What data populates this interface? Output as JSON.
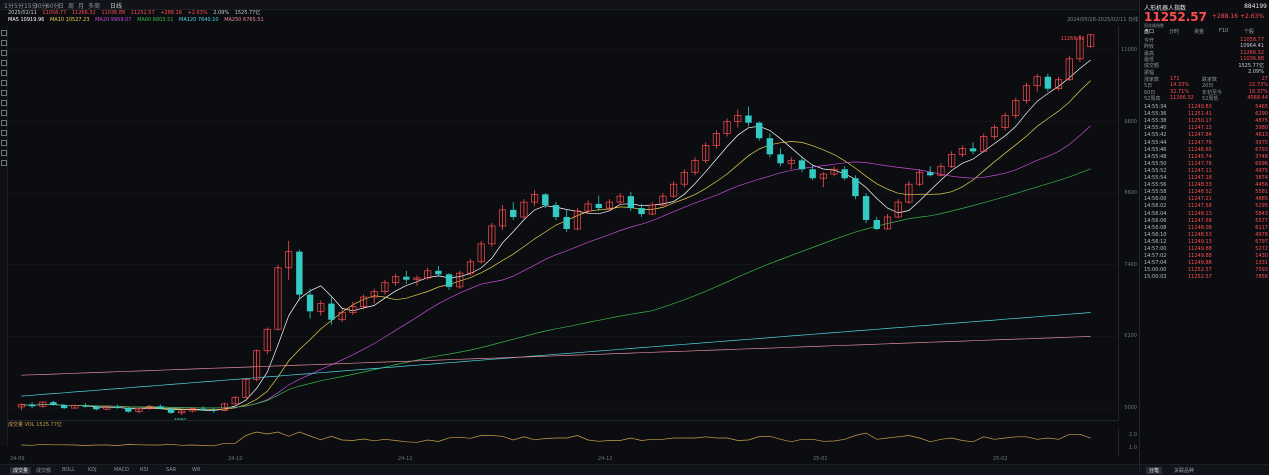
{
  "toolbar": {
    "items": [
      "1分",
      "5分",
      "15分",
      "30分",
      "60分",
      "日",
      "周",
      "月",
      "多周"
    ],
    "chart_mode": "日线"
  },
  "infobar": {
    "date": "2025/02/11",
    "open": "11058.77",
    "high": "11266.32",
    "low": "11036.88",
    "close": "11252.57",
    "change": "+288.16",
    "pct": "+2.63%",
    "amp": "2.09%",
    "vol": "1525.77亿"
  },
  "mabar": {
    "ma5": "MA5 10919.96",
    "ma10": "MA10 10527.23",
    "ma20": "MA20 9959.07",
    "ma60": "MA60 8803.51",
    "ma120": "MA120 7640.10",
    "ma250": "MA250 6765.51"
  },
  "date_range": "2024/05/28-2025/02/11 日线",
  "yaxis": {
    "labels": [
      "11000",
      "9800",
      "8600",
      "7400",
      "6200",
      "5000"
    ]
  },
  "sub_indicator": {
    "label": "成交量 VOL 1525.77亿",
    "yaxis": [
      "2.0",
      "1.0"
    ]
  },
  "xaxis": {
    "labels": [
      "24-09",
      "24-10",
      "24-11",
      "24-12",
      "25-01",
      "25-02"
    ]
  },
  "bottom_tabs": [
    "成交量",
    "成交额",
    "BOLL",
    "KDJ",
    "MACD",
    "RSI",
    "SAR",
    "WR"
  ],
  "colors": {
    "up": "#ff4d4f",
    "down": "#35c9c4",
    "ma5": "#ffffff",
    "ma10": "#e6d24a",
    "ma20": "#c64cd8",
    "ma60": "#39b54a",
    "ma120": "#4ad6e0",
    "ma250": "#e38b9a"
  },
  "right_panel": {
    "name": "人形机器人指数",
    "code": "884199",
    "price": "11252.57",
    "change": "+288.16",
    "pct": "+2.63%",
    "subline": "同花顺指数",
    "tabs": [
      "盘口",
      "分时",
      "资金",
      "F10",
      "个股"
    ],
    "kv": [
      {
        "k": "今开",
        "v": "11058.77",
        "c": "up"
      },
      {
        "k": "昨收",
        "v": "10964.41",
        "c": ""
      },
      {
        "k": "最高",
        "v": "11266.32",
        "c": "up"
      },
      {
        "k": "最低",
        "v": "11036.88",
        "c": "up"
      },
      {
        "k": "成交额",
        "v": "1525.77亿",
        "c": ""
      },
      {
        "k": "振幅",
        "v": "2.09%",
        "c": ""
      }
    ],
    "stats": [
      {
        "a": "涨家数",
        "b": "171",
        "c": "跌家数",
        "d": "27"
      },
      {
        "a": "5日",
        "b": "14.33%",
        "c": "20日",
        "d": "22.73%"
      },
      {
        "a": "60日",
        "b": "32.71%",
        "c": "年初至今",
        "d": "16.37%"
      },
      {
        "a": "52周高",
        "b": "11266.32",
        "c": "52周低",
        "d": "4568.44"
      }
    ],
    "ticks": [
      {
        "t": "14:55:34",
        "p": "11249.83",
        "v": "5465"
      },
      {
        "t": "14:55:36",
        "p": "11251.41",
        "v": "6290"
      },
      {
        "t": "14:55:38",
        "p": "11250.17",
        "v": "4875"
      },
      {
        "t": "14:55:40",
        "p": "11247.12",
        "v": "3980"
      },
      {
        "t": "14:55:42",
        "p": "11247.84",
        "v": "4613"
      },
      {
        "t": "14:55:44",
        "p": "11247.76",
        "v": "3975"
      },
      {
        "t": "14:55:46",
        "p": "11246.65",
        "v": "6793"
      },
      {
        "t": "14:55:48",
        "p": "11245.74",
        "v": "3748"
      },
      {
        "t": "14:55:50",
        "p": "11247.76",
        "v": "6696"
      },
      {
        "t": "14:55:52",
        "p": "11247.11",
        "v": "4975"
      },
      {
        "t": "14:55:54",
        "p": "11247.18",
        "v": "3874"
      },
      {
        "t": "14:55:56",
        "p": "11248.33",
        "v": "4456"
      },
      {
        "t": "14:55:58",
        "p": "11248.52",
        "v": "5581"
      },
      {
        "t": "14:56:00",
        "p": "11247.21",
        "v": "4885"
      },
      {
        "t": "14:56:02",
        "p": "11247.58",
        "v": "5295"
      },
      {
        "t": "14:56:04",
        "p": "11248.13",
        "v": "5843"
      },
      {
        "t": "14:56:06",
        "p": "11247.58",
        "v": "5577"
      },
      {
        "t": "14:56:08",
        "p": "11248.08",
        "v": "6117"
      },
      {
        "t": "14:56:10",
        "p": "11248.53",
        "v": "4978"
      },
      {
        "t": "14:56:12",
        "p": "11249.13",
        "v": "6797"
      },
      {
        "t": "14:57:00",
        "p": "11249.88",
        "v": "5272"
      },
      {
        "t": "14:57:02",
        "p": "11249.88",
        "v": "1430"
      },
      {
        "t": "14:57:04",
        "p": "11249.88",
        "v": "1331"
      },
      {
        "t": "15:00:00",
        "p": "11252.57",
        "v": "7593"
      },
      {
        "t": "15:00:03",
        "p": "11252.57",
        "v": "7856"
      }
    ],
    "bottom": [
      "分笔",
      "关联品种"
    ]
  },
  "chart_data": {
    "type": "candlestick",
    "x": [
      "24-09",
      "24-10",
      "24-11",
      "24-12",
      "25-01",
      "25-02"
    ],
    "ylim": [
      4800,
      11400
    ],
    "candles": [
      [
        5020,
        5080,
        4960,
        5060
      ],
      [
        5060,
        5100,
        5000,
        5030
      ],
      [
        5030,
        5110,
        5010,
        5100
      ],
      [
        5100,
        5120,
        5040,
        5050
      ],
      [
        5050,
        5070,
        4980,
        5000
      ],
      [
        5000,
        5060,
        4990,
        5040
      ],
      [
        5040,
        5080,
        5010,
        5020
      ],
      [
        5020,
        5050,
        4960,
        4980
      ],
      [
        4980,
        5040,
        4970,
        5020
      ],
      [
        5020,
        5060,
        4990,
        5000
      ],
      [
        5000,
        5020,
        4920,
        4940
      ],
      [
        4940,
        5000,
        4910,
        4990
      ],
      [
        4990,
        5050,
        4970,
        5030
      ],
      [
        5030,
        5060,
        4980,
        4990
      ],
      [
        4990,
        5010,
        4900,
        4920
      ],
      [
        4920,
        4960,
        4880,
        4950
      ],
      [
        4950,
        5010,
        4930,
        4990
      ],
      [
        4990,
        5030,
        4950,
        4970
      ],
      [
        4970,
        5000,
        4920,
        4960
      ],
      [
        4960,
        5090,
        4950,
        5070
      ],
      [
        5070,
        5200,
        5060,
        5180
      ],
      [
        5180,
        5500,
        5170,
        5480
      ],
      [
        5480,
        5980,
        5450,
        5960
      ],
      [
        5960,
        6350,
        5900,
        6320
      ],
      [
        6320,
        7400,
        6300,
        7350
      ],
      [
        7350,
        7800,
        7150,
        7620
      ],
      [
        7620,
        7650,
        6800,
        6900
      ],
      [
        6900,
        7000,
        6500,
        6620
      ],
      [
        6620,
        6800,
        6550,
        6750
      ],
      [
        6750,
        6880,
        6400,
        6480
      ],
      [
        6480,
        6650,
        6440,
        6600
      ],
      [
        6600,
        6780,
        6560,
        6700
      ],
      [
        6700,
        6900,
        6650,
        6860
      ],
      [
        6860,
        7000,
        6750,
        6950
      ],
      [
        6950,
        7150,
        6900,
        7100
      ],
      [
        7100,
        7250,
        7050,
        7200
      ],
      [
        7200,
        7300,
        7080,
        7150
      ],
      [
        7150,
        7220,
        7050,
        7180
      ],
      [
        7180,
        7350,
        7150,
        7300
      ],
      [
        7300,
        7380,
        7200,
        7240
      ],
      [
        7240,
        7260,
        6980,
        7030
      ],
      [
        7030,
        7300,
        7000,
        7260
      ],
      [
        7260,
        7500,
        7220,
        7450
      ],
      [
        7450,
        7800,
        7420,
        7750
      ],
      [
        7750,
        8100,
        7700,
        8050
      ],
      [
        8050,
        8400,
        7980,
        8320
      ],
      [
        8320,
        8450,
        8150,
        8200
      ],
      [
        8200,
        8500,
        8180,
        8450
      ],
      [
        8450,
        8650,
        8380,
        8580
      ],
      [
        8580,
        8600,
        8350,
        8400
      ],
      [
        8400,
        8450,
        8150,
        8200
      ],
      [
        8200,
        8320,
        7950,
        8000
      ],
      [
        8000,
        8350,
        7980,
        8300
      ],
      [
        8300,
        8480,
        8250,
        8420
      ],
      [
        8420,
        8560,
        8300,
        8350
      ],
      [
        8350,
        8500,
        8320,
        8450
      ],
      [
        8450,
        8600,
        8400,
        8550
      ],
      [
        8550,
        8620,
        8300,
        8350
      ],
      [
        8350,
        8420,
        8200,
        8250
      ],
      [
        8250,
        8450,
        8230,
        8400
      ],
      [
        8400,
        8600,
        8380,
        8550
      ],
      [
        8550,
        8800,
        8520,
        8750
      ],
      [
        8750,
        9000,
        8700,
        8950
      ],
      [
        8950,
        9200,
        8900,
        9150
      ],
      [
        9150,
        9450,
        9100,
        9400
      ],
      [
        9400,
        9650,
        9350,
        9600
      ],
      [
        9600,
        9850,
        9550,
        9800
      ],
      [
        9800,
        10000,
        9700,
        9900
      ],
      [
        9900,
        10050,
        9720,
        9780
      ],
      [
        9780,
        9800,
        9480,
        9520
      ],
      [
        9520,
        9600,
        9200,
        9250
      ],
      [
        9250,
        9350,
        9050,
        9100
      ],
      [
        9100,
        9200,
        9000,
        9150
      ],
      [
        9150,
        9220,
        8950,
        9000
      ],
      [
        9000,
        9080,
        8820,
        8850
      ],
      [
        8850,
        8950,
        8700,
        8920
      ],
      [
        8920,
        9050,
        8880,
        9000
      ],
      [
        9000,
        9050,
        8820,
        8850
      ],
      [
        8850,
        8900,
        8500,
        8550
      ],
      [
        8550,
        8600,
        8100,
        8150
      ],
      [
        8150,
        8200,
        7980,
        8000
      ],
      [
        8000,
        8250,
        7990,
        8200
      ],
      [
        8200,
        8500,
        8180,
        8450
      ],
      [
        8450,
        8800,
        8420,
        8750
      ],
      [
        8750,
        9000,
        8720,
        8950
      ],
      [
        8950,
        9050,
        8880,
        8900
      ],
      [
        8900,
        9100,
        8880,
        9050
      ],
      [
        9050,
        9300,
        9020,
        9250
      ],
      [
        9250,
        9400,
        9200,
        9350
      ],
      [
        9350,
        9450,
        9250,
        9300
      ],
      [
        9300,
        9600,
        9280,
        9550
      ],
      [
        9550,
        9750,
        9500,
        9700
      ],
      [
        9700,
        9950,
        9650,
        9900
      ],
      [
        9900,
        10200,
        9850,
        10150
      ],
      [
        10150,
        10450,
        10100,
        10400
      ],
      [
        10400,
        10600,
        10300,
        10550
      ],
      [
        10550,
        10600,
        10300,
        10350
      ],
      [
        10350,
        10550,
        10320,
        10500
      ],
      [
        10500,
        10900,
        10480,
        10850
      ],
      [
        10850,
        11250,
        10800,
        11200
      ],
      [
        11058.77,
        11266.32,
        11036.88,
        11252.57
      ]
    ]
  }
}
